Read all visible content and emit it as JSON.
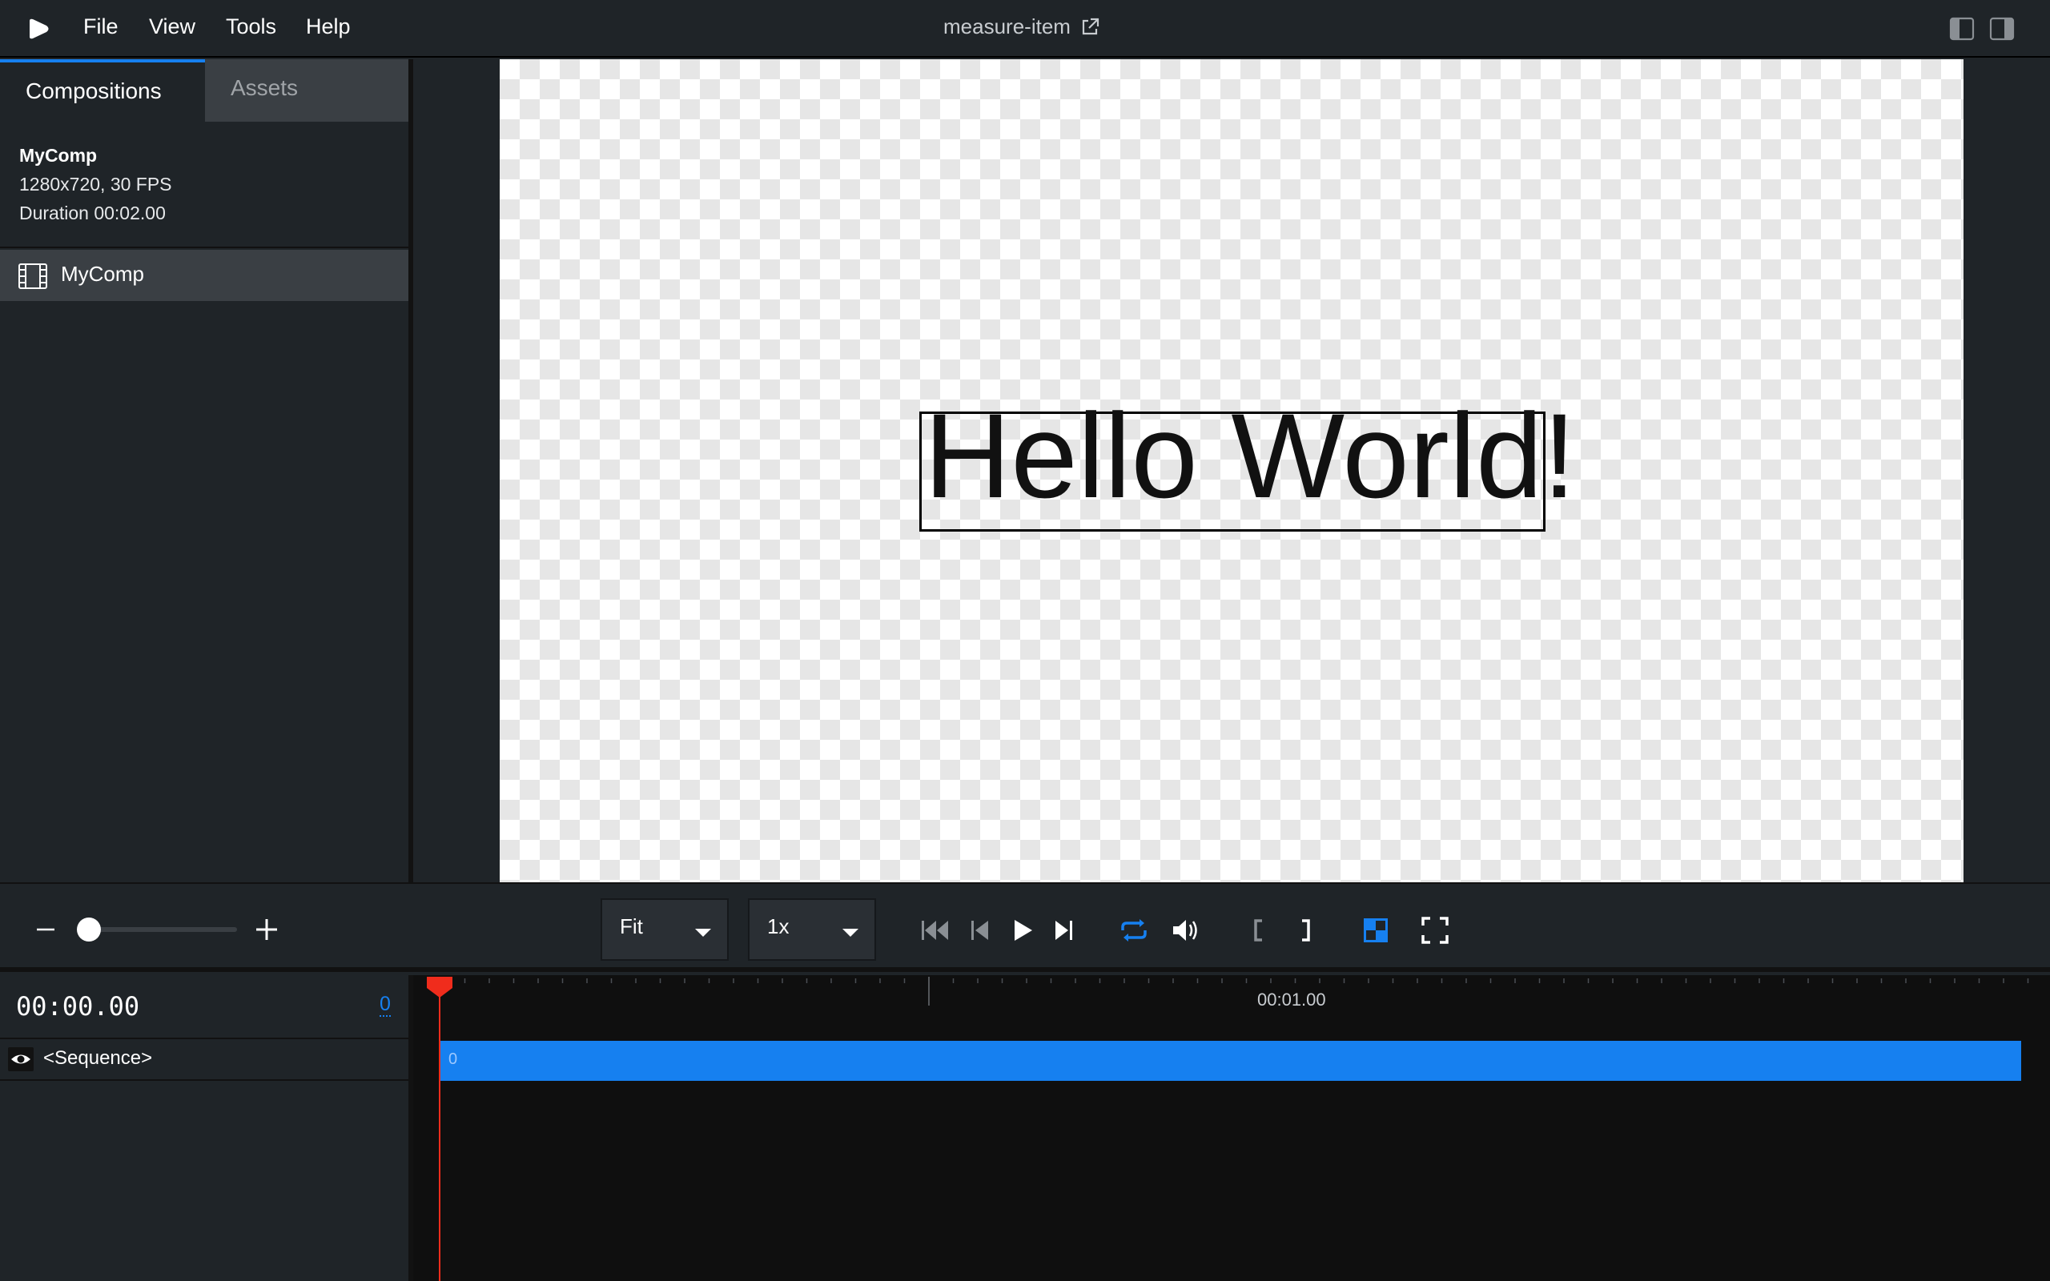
{
  "menubar": {
    "items": [
      "File",
      "View",
      "Tools",
      "Help"
    ],
    "title": "measure-item"
  },
  "sidebar": {
    "tabs": [
      "Compositions",
      "Assets"
    ],
    "active_tab": "Compositions",
    "composition": {
      "name": "MyComp",
      "resolution_fps": "1280x720, 30 FPS",
      "duration": "Duration 00:02.00"
    },
    "list": [
      {
        "label": "MyComp"
      }
    ]
  },
  "canvas": {
    "text": "Hello World!"
  },
  "controls": {
    "zoom_select": "Fit",
    "speed_select": "1x",
    "zoom_level": 0.0
  },
  "timeline": {
    "timecode": "00:00.00",
    "frame": "0",
    "ruler_label": "00:01.00",
    "track": {
      "label": "<Sequence>",
      "bar_label": "0"
    }
  },
  "colors": {
    "accent": "#1680f0",
    "playhead": "#f02c1c",
    "background": "#1f2428"
  }
}
